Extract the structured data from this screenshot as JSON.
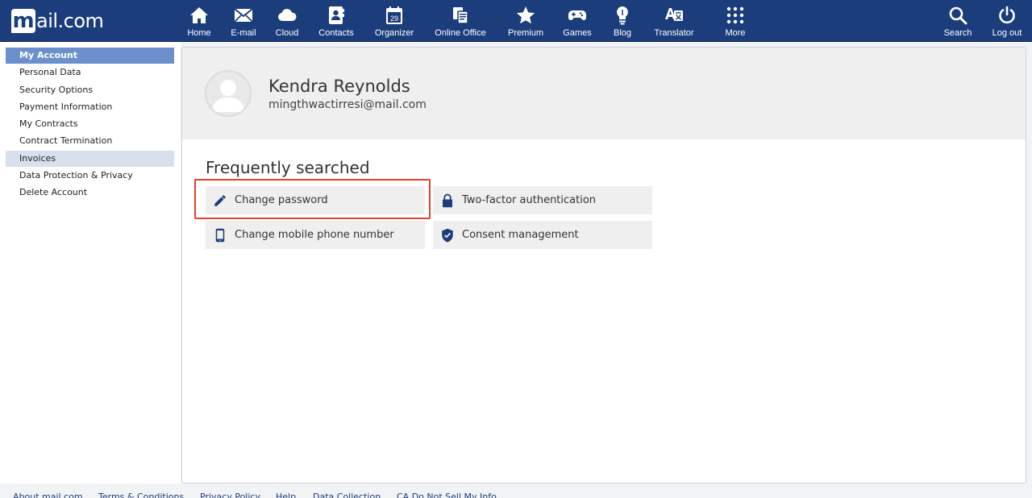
{
  "brand": {
    "logo_letter": "m",
    "logo_text": "ail.com"
  },
  "nav": {
    "items": [
      {
        "label": "Home",
        "icon": "home-icon"
      },
      {
        "label": "E-mail",
        "icon": "mail-icon"
      },
      {
        "label": "Cloud",
        "icon": "cloud-icon"
      },
      {
        "label": "Contacts",
        "icon": "contacts-icon"
      },
      {
        "label": "Organizer",
        "icon": "calendar-icon",
        "badge": "29"
      },
      {
        "label": "Online Office",
        "icon": "office-icon"
      },
      {
        "label": "Premium",
        "icon": "star-icon"
      },
      {
        "label": "Games",
        "icon": "gamepad-icon"
      },
      {
        "label": "Blog",
        "icon": "lightbulb-icon"
      },
      {
        "label": "Translator",
        "icon": "translator-icon"
      },
      {
        "label": "More",
        "icon": "grid-icon"
      }
    ],
    "search_label": "Search",
    "logout_label": "Log out"
  },
  "sidebar": {
    "items": [
      {
        "label": "My Account",
        "state": "header"
      },
      {
        "label": "Personal Data"
      },
      {
        "label": "Security Options"
      },
      {
        "label": "Payment Information"
      },
      {
        "label": "My Contracts"
      },
      {
        "label": "Contract Termination"
      },
      {
        "label": "Invoices",
        "state": "selected"
      },
      {
        "label": "Data Protection & Privacy"
      },
      {
        "label": "Delete Account"
      }
    ]
  },
  "profile": {
    "name": "Kendra Reynolds",
    "email": "mingthwactirresi@mail.com"
  },
  "frequently_searched": {
    "title": "Frequently searched",
    "tiles": [
      {
        "label": "Change password",
        "icon": "pencil-icon"
      },
      {
        "label": "Two-factor authentication",
        "icon": "lock-icon"
      },
      {
        "label": "Change mobile phone number",
        "icon": "phone-icon"
      },
      {
        "label": "Consent management",
        "icon": "shield-check-icon"
      }
    ]
  },
  "footer": {
    "links": [
      "About mail.com",
      "Terms & Conditions",
      "Privacy Policy",
      "Help",
      "Data Collection",
      "CA Do Not Sell My Info"
    ]
  },
  "colors": {
    "brand": "#1b3d7c",
    "sidebar_header": "#6c90cd",
    "sidebar_selected": "#d8e0ee",
    "highlight": "#e0432b"
  }
}
